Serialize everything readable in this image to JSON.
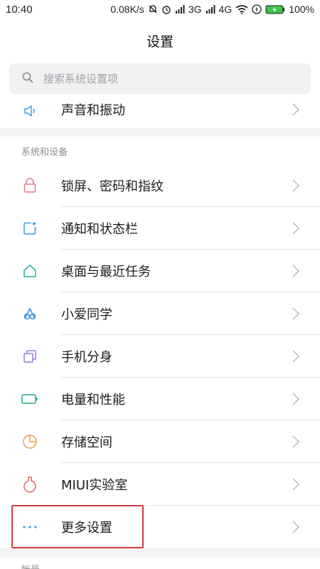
{
  "status_bar": {
    "time": "10:40",
    "speed": "0.08K/s",
    "network_3g": "3G",
    "network_4g": "4G",
    "battery": "100%"
  },
  "header": {
    "title": "设置"
  },
  "search": {
    "placeholder": "搜索系统设置项"
  },
  "top_item": {
    "label": "声音和振动",
    "icon": "speaker-icon"
  },
  "section_system": {
    "title": "系统和设备",
    "items": [
      {
        "label": "锁屏、密码和指纹",
        "icon": "lock-icon",
        "color": "#e07a8a"
      },
      {
        "label": "通知和状态栏",
        "icon": "notification-icon",
        "color": "#3aa0e0"
      },
      {
        "label": "桌面与最近任务",
        "icon": "home-icon",
        "color": "#27b0a4"
      },
      {
        "label": "小爱同学",
        "icon": "assistant-icon",
        "color": "#3a8de0"
      },
      {
        "label": "手机分身",
        "icon": "dual-phone-icon",
        "color": "#9a7ad8"
      },
      {
        "label": "电量和性能",
        "icon": "battery-icon",
        "color": "#27b07a"
      },
      {
        "label": "存储空间",
        "icon": "storage-pie-icon",
        "color": "#f29a4a"
      },
      {
        "label": "MIUI实验室",
        "icon": "lab-flask-icon",
        "color": "#e06a6a"
      },
      {
        "label": "更多设置",
        "icon": "more-dots-icon",
        "color": "#3aa0e0"
      }
    ]
  },
  "section_account": {
    "title": "帐号"
  }
}
